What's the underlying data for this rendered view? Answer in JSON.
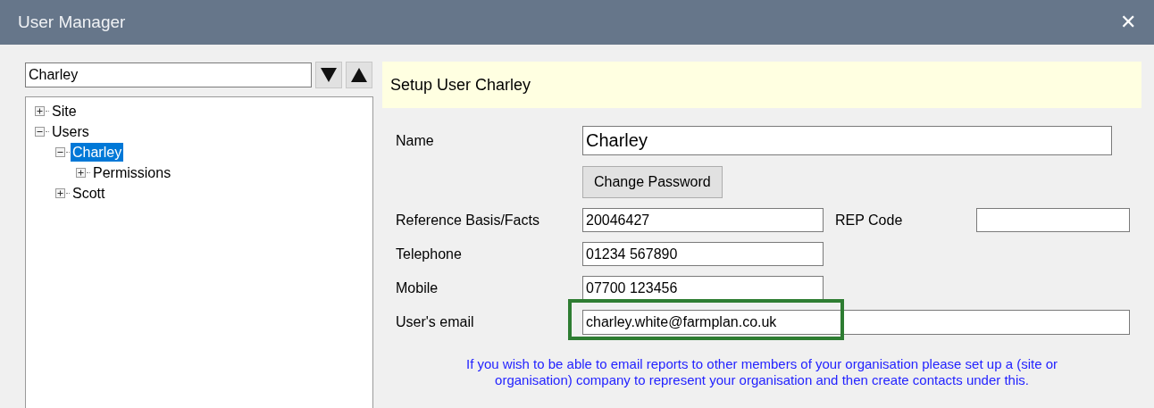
{
  "window": {
    "title": "User Manager",
    "close": "✕"
  },
  "search": {
    "value": "Charley"
  },
  "tree": [
    {
      "label": "Site",
      "expanded": false,
      "selected": false
    },
    {
      "label": "Users",
      "expanded": true,
      "selected": false,
      "children": [
        {
          "label": "Charley",
          "expanded": true,
          "selected": true,
          "children": [
            {
              "label": "Permissions",
              "expanded": false,
              "selected": false
            }
          ]
        },
        {
          "label": "Scott",
          "expanded": false,
          "selected": false
        }
      ]
    }
  ],
  "header": {
    "title": "Setup User Charley"
  },
  "form": {
    "name": {
      "label": "Name",
      "value": "Charley"
    },
    "change_password": "Change Password",
    "reference": {
      "label": "Reference Basis/Facts",
      "value": "20046427"
    },
    "rep_code": {
      "label": "REP Code"
    },
    "telephone": {
      "label": "Telephone",
      "value": "01234 567890"
    },
    "mobile": {
      "label": "Mobile",
      "value": "07700 123456"
    },
    "email": {
      "label": "User's email",
      "value": "charley.white@farmplan.co.uk",
      "highlighted": true
    },
    "note": "If you wish to be able to email reports to other members of your organisation please set up a (site or organisation) company to represent your organisation and then create contacts under this."
  }
}
